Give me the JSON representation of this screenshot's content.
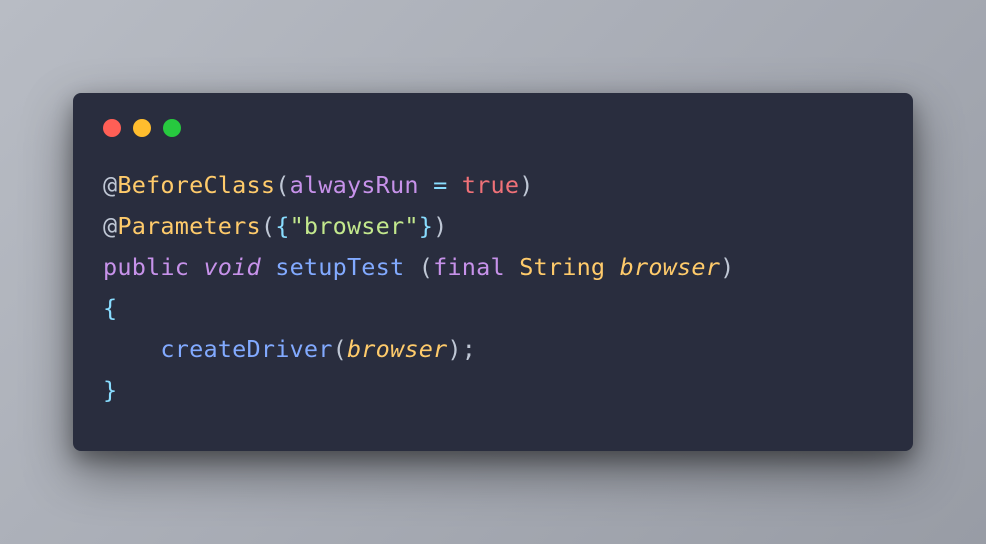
{
  "colors": {
    "background": "#292d3e",
    "red": "#ff5f56",
    "yellow": "#ffbd2e",
    "green": "#27c93f"
  },
  "code": {
    "l1": {
      "at": "@",
      "annot": "BeforeClass",
      "open": "(",
      "param": "alwaysRun",
      "sp1": " ",
      "op": "=",
      "sp2": " ",
      "val": "true",
      "close": ")"
    },
    "l2": {
      "at": "@",
      "annot": "Parameters",
      "open": "(",
      "lbrace": "{",
      "str": "\"browser\"",
      "rbrace": "}",
      "close": ")"
    },
    "l3": {
      "pub": "public",
      "sp1": " ",
      "void": "void",
      "sp2": " ",
      "method": "setupTest",
      "sp3": " ",
      "open": "(",
      "final": "final",
      "sp4": " ",
      "type": "String",
      "sp5": " ",
      "arg": "browser",
      "close": ")"
    },
    "l4": {
      "lbrace": "{"
    },
    "l5": {
      "indent": "    ",
      "call": "createDriver",
      "open": "(",
      "arg": "browser",
      "close": ")",
      "semi": ";"
    },
    "l6": {
      "rbrace": "}"
    }
  }
}
